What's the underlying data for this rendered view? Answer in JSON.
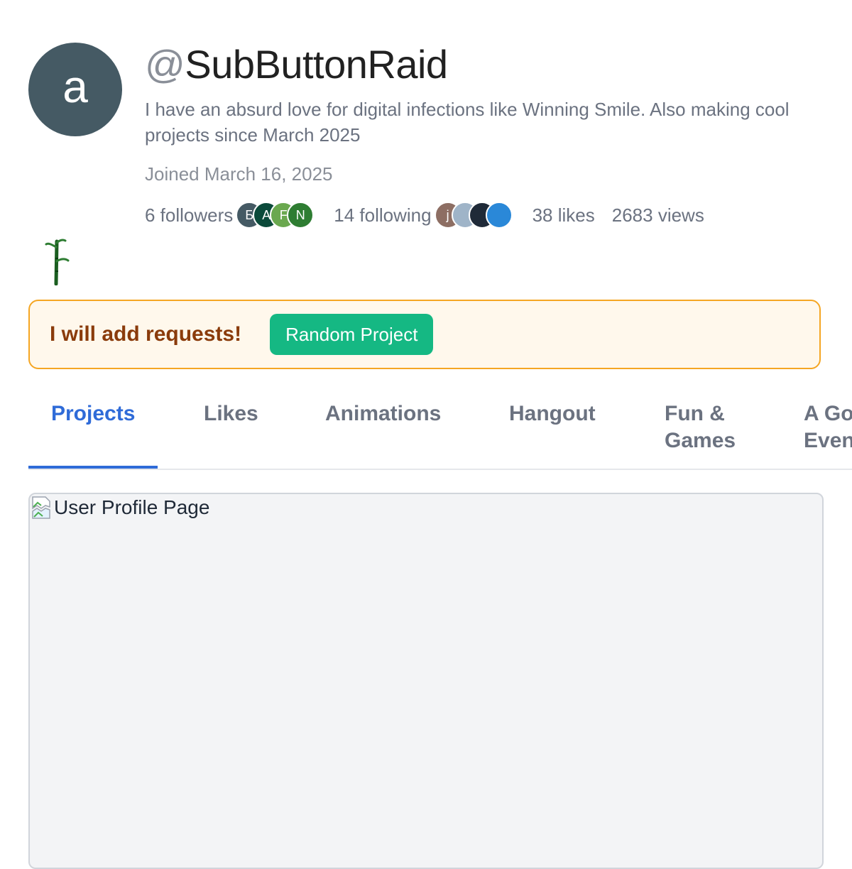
{
  "profile": {
    "avatar_letter": "a",
    "avatar_color": "#455a64",
    "username_prefix": "@",
    "username": "SubButtonRaid",
    "bio": "I have an absurd love for digital infections like Winning Smile. Also making cool projects since March 2025",
    "joined": "Joined March 16, 2025"
  },
  "stats": {
    "followers": "6 followers",
    "followers_avatars": [
      {
        "letter": "Б",
        "color": "#455a64"
      },
      {
        "letter": "A",
        "color": "#0b4a3a"
      },
      {
        "letter": "F",
        "color": "#6aa84f"
      },
      {
        "letter": "N",
        "color": "#2e7d32"
      }
    ],
    "following": "14 following",
    "following_avatars": [
      {
        "letter": "j",
        "color": "#8d6e63"
      },
      {
        "letter": "",
        "color": "#9fb4c8"
      },
      {
        "letter": "",
        "color": "#1f2a38"
      },
      {
        "letter": "",
        "color": "#2a88d8"
      }
    ],
    "likes": "38 likes",
    "views": "2683 views"
  },
  "banner": {
    "text": "I will add requests!",
    "button_label": "Random Project",
    "border_color": "#f5a623",
    "button_color": "#15b883"
  },
  "tabs": [
    {
      "label": "Projects",
      "active": true
    },
    {
      "label": "Likes",
      "active": false
    },
    {
      "label": "Animations",
      "active": false
    },
    {
      "label": "Hangout",
      "active": false
    },
    {
      "label": "Fun &\nGames",
      "active": false
    },
    {
      "label": "A Go\nEven",
      "active": false
    }
  ],
  "content": {
    "broken_image_alt": "User Profile Page"
  },
  "icons": {
    "plant": "bamboo-sprout-icon",
    "broken_image": "broken-image-icon"
  }
}
